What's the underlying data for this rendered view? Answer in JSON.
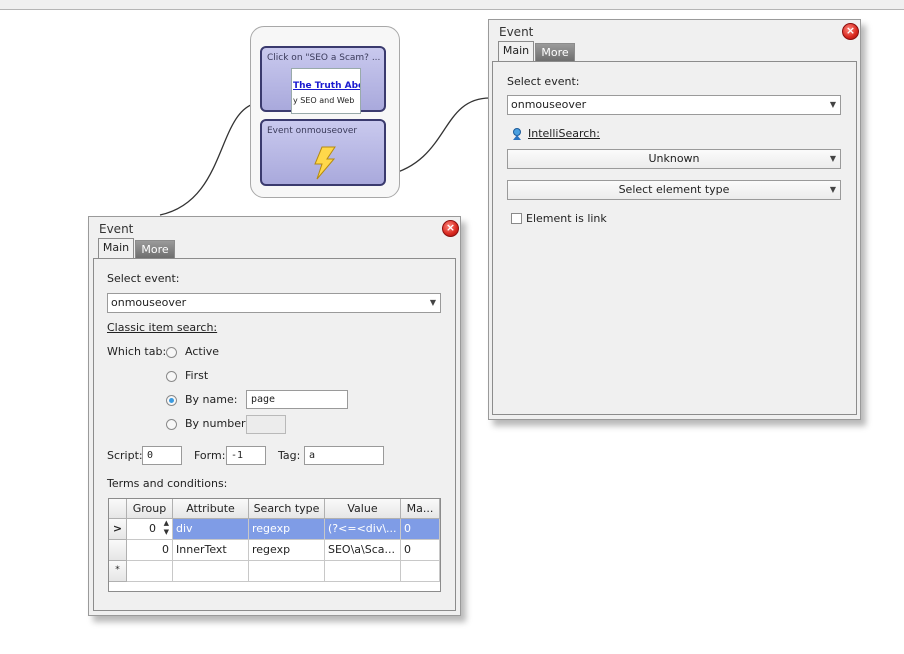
{
  "flow": {
    "node1": {
      "title": "Click on \"SEO a Scam? ...",
      "thumb_link": "The Truth Abou",
      "thumb_sub": "y SEO and Web"
    },
    "node2": {
      "title": "Event onmouseover",
      "icon": "lightning-icon"
    }
  },
  "dialog_right": {
    "title": "Event",
    "tabs": [
      "Main",
      "More"
    ],
    "select_event_label": "Select event:",
    "select_event_value": "onmouseover",
    "intellisearch_label": "IntelliSearch:",
    "unknown_value": "Unknown",
    "element_type_value": "Select element type",
    "element_is_link_label": "Element is link"
  },
  "dialog_left": {
    "title": "Event",
    "tabs": [
      "Main",
      "More"
    ],
    "select_event_label": "Select event:",
    "select_event_value": "onmouseover",
    "classic_search_label": "Classic item search:",
    "which_tab_label": "Which tab:",
    "radio_active": "Active",
    "radio_first": "First",
    "radio_by_name": "By name:",
    "by_name_value": "page",
    "radio_by_number": "By number:",
    "by_number_value": "",
    "script_label": "Script:",
    "script_value": "0",
    "form_label": "Form:",
    "form_value": "-1",
    "tag_label": "Tag:",
    "tag_value": "a",
    "terms_label": "Terms and conditions:",
    "grid": {
      "headers": [
        "Group",
        "Attribute",
        "Search type",
        "Value",
        "Ma..."
      ],
      "rows": [
        {
          "indicator": ">",
          "group": "0",
          "attribute": "div",
          "search_type": "regexp",
          "value": "(?<=<div\\...",
          "match": "0"
        },
        {
          "indicator": "",
          "group": "0",
          "attribute": "InnerText",
          "search_type": "regexp",
          "value": "SEO\\a\\Sca...",
          "match": "0"
        }
      ],
      "new_row_indicator": "*"
    }
  },
  "colors": {
    "selection": "#7f9ce6",
    "node_fill": "#b5b5e4",
    "close_red": "#d8271e"
  }
}
